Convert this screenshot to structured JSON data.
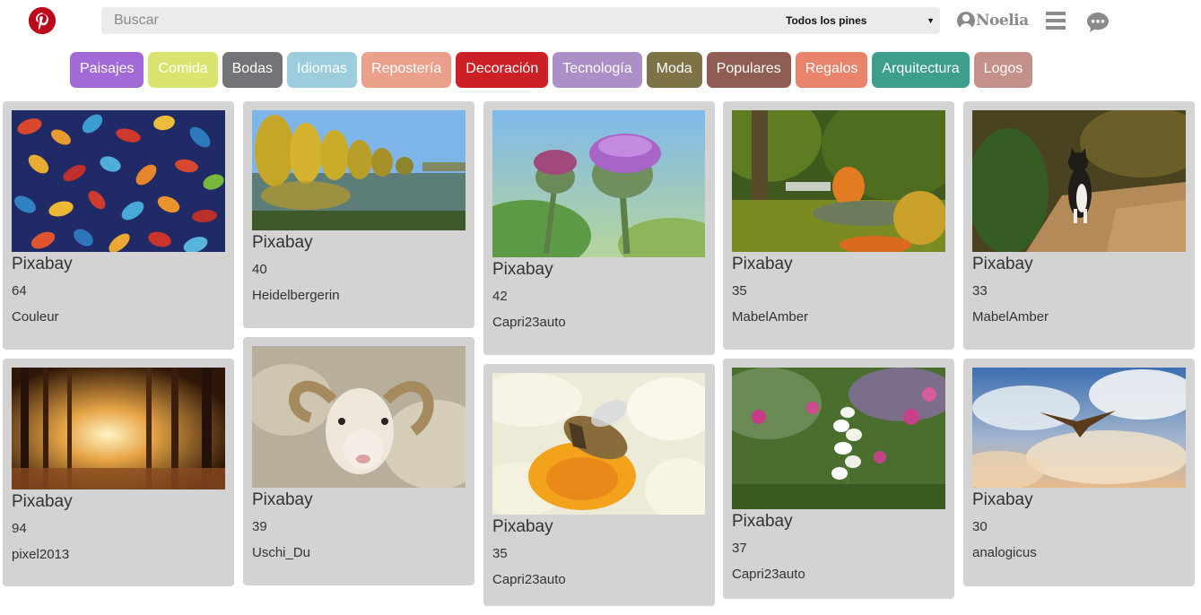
{
  "header": {
    "search_placeholder": "Buscar",
    "filter_selected": "Todos los pines",
    "user_name": "Noelia"
  },
  "categories": [
    {
      "label": "Paisajes",
      "color": "#a36ad7"
    },
    {
      "label": "Comida",
      "color": "#d9e56e"
    },
    {
      "label": "Bodas",
      "color": "#737477"
    },
    {
      "label": "Idiomas",
      "color": "#9ccddc"
    },
    {
      "label": "Repostería",
      "color": "#eba08c"
    },
    {
      "label": "Decoración",
      "color": "#cd1f26"
    },
    {
      "label": "Tecnología",
      "color": "#ac8fc6"
    },
    {
      "label": "Moda",
      "color": "#7d7346"
    },
    {
      "label": "Populares",
      "color": "#8f5d52"
    },
    {
      "label": "Regalos",
      "color": "#e9836c"
    },
    {
      "label": "Arquitectura",
      "color": "#3d9e8c"
    },
    {
      "label": "Logos",
      "color": "#c4908a"
    }
  ],
  "pins": [
    {
      "title": "Pixabay",
      "count": "64",
      "user": "Couleur",
      "image": "autumn-leaves-icon"
    },
    {
      "title": "Pixabay",
      "count": "94",
      "user": "pixel2013",
      "image": "sunlit-forest-icon"
    },
    {
      "title": "Pixabay",
      "count": "40",
      "user": "Heidelbergerin",
      "image": "lake-trees-icon"
    },
    {
      "title": "Pixabay",
      "count": "39",
      "user": "Uschi_Du",
      "image": "sheep-icon"
    },
    {
      "title": "Pixabay",
      "count": "42",
      "user": "Capri23auto",
      "image": "thistle-flower-icon"
    },
    {
      "title": "Pixabay",
      "count": "35",
      "user": "Capri23auto",
      "image": "bee-flower-icon"
    },
    {
      "title": "Pixabay",
      "count": "35",
      "user": "MabelAmber",
      "image": "autumn-park-icon"
    },
    {
      "title": "Pixabay",
      "count": "37",
      "user": "Capri23auto",
      "image": "garden-flowers-icon"
    },
    {
      "title": "Pixabay",
      "count": "33",
      "user": "MabelAmber",
      "image": "cat-path-icon"
    },
    {
      "title": "Pixabay",
      "count": "30",
      "user": "analogicus",
      "image": "bird-sky-icon"
    }
  ]
}
